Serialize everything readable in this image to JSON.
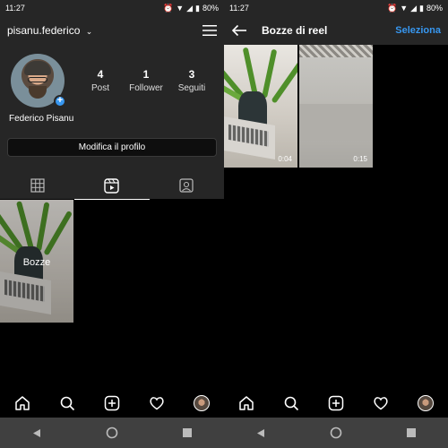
{
  "left": {
    "status": {
      "time": "11:27",
      "battery": "80%"
    },
    "header": {
      "username": "pisanu.federico"
    },
    "profile": {
      "name": "Federico Pisanu",
      "stats": [
        {
          "value": "4",
          "label": "Post"
        },
        {
          "value": "1",
          "label": "Follower"
        },
        {
          "value": "3",
          "label": "Seguiti"
        }
      ],
      "edit_label": "Modifica il profilo"
    },
    "grid": {
      "thumb_label": "Bozze"
    }
  },
  "right": {
    "status": {
      "time": "11:27",
      "battery": "80%"
    },
    "header": {
      "title": "Bozze di reel",
      "select_label": "Seleziona"
    },
    "drafts": [
      {
        "duration": "0:04"
      },
      {
        "duration": "0:15"
      }
    ]
  },
  "colors": {
    "accent": "#3797f0",
    "bar": "#262626",
    "background": "#000000",
    "system_nav": "#404040"
  }
}
